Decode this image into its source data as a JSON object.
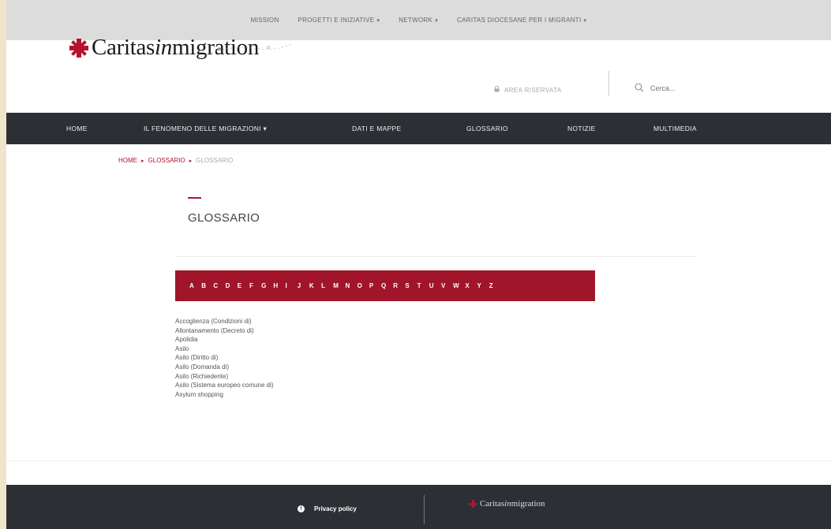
{
  "topbar": {
    "items": [
      {
        "label": "MISSION",
        "dropdown": false
      },
      {
        "label": "PROGETTI E INIZIATIVE",
        "dropdown": true
      },
      {
        "label": "NETWORK",
        "dropdown": true
      },
      {
        "label": "CARITAS DIOCESANE PER I MIGRANTI",
        "dropdown": true
      }
    ]
  },
  "header": {
    "logo": {
      "prefix": "Caritas",
      "italic": "in",
      "suffix": "migration"
    },
    "reserved_area": "AREA RISERVATA",
    "search_placeholder": "Cerca..."
  },
  "mainnav": {
    "items": [
      {
        "label": "HOME"
      },
      {
        "label": "IL FENOMENO DELLE MIGRAZIONI ▾"
      },
      {
        "label": "DATI E MAPPE"
      },
      {
        "label": "GLOSSARIO"
      },
      {
        "label": "NOTIZIE"
      },
      {
        "label": "MULTIMEDIA"
      }
    ]
  },
  "breadcrumb": {
    "home": "HOME",
    "section": "GLOSSARIO",
    "current": "GLOSSARIO"
  },
  "page_title": "GLOSSARIO",
  "alphabet": [
    "A",
    "B",
    "C",
    "D",
    "E",
    "F",
    "G",
    "H",
    "I",
    "J",
    "K",
    "L",
    "M",
    "N",
    "O",
    "P",
    "Q",
    "R",
    "S",
    "T",
    "U",
    "V",
    "W",
    "X",
    "Y",
    "Z"
  ],
  "terms": [
    "Accoglienza (Condizioni di)",
    "Allontanamento (Decreto di)",
    "Apolidia",
    "Asilo",
    "Asilo (Diritto di)",
    "Asilo (Domanda di)",
    "Asilo (Richiedente)",
    "Asilo (Sistema europeo comune di)",
    "Asylum shopping"
  ],
  "footer": {
    "privacy": "Privacy policy",
    "logo": {
      "prefix": "Caritas",
      "italic": "in",
      "suffix": "migration"
    }
  },
  "colors": {
    "accent": "#b3132c",
    "alphabet_bg": "#a0152a",
    "dark": "#2c3035"
  }
}
